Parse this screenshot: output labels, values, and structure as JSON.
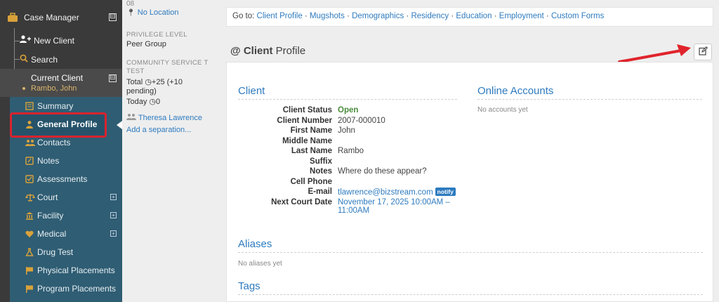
{
  "sidebar": {
    "case_manager": "Case Manager",
    "new_client": "New Client",
    "search": "Search",
    "current_client_label": "Current Client",
    "current_client_name": "Rambo, John",
    "toggle_symbol": "⊟",
    "items": [
      {
        "label": "Summary",
        "icon": "summary-icon"
      },
      {
        "label": "General Profile",
        "icon": "person-icon"
      },
      {
        "label": "Contacts",
        "icon": "contacts-icon"
      },
      {
        "label": "Notes",
        "icon": "notes-icon"
      },
      {
        "label": "Assessments",
        "icon": "assessments-icon"
      },
      {
        "label": "Court",
        "icon": "scales-icon",
        "expandable": true
      },
      {
        "label": "Facility",
        "icon": "building-icon",
        "expandable": true
      },
      {
        "label": "Medical",
        "icon": "heart-icon",
        "expandable": true
      },
      {
        "label": "Drug Test",
        "icon": "flask-icon"
      },
      {
        "label": "Physical Placements",
        "icon": "flag-icon"
      },
      {
        "label": "Program Placements",
        "icon": "flag-icon"
      }
    ],
    "plus_symbol": "+"
  },
  "midcol": {
    "top_fragment": "08",
    "location": "No Location",
    "privilege_label": "PRIVILEGE LEVEL",
    "privilege_value": "Peer Group",
    "community_label_1": "COMMUNITY SERVICE T",
    "community_label_2": "TEST",
    "total_text": "Total",
    "total_value": "+25 (+10",
    "total_pending": "pending)",
    "today_text": "Today",
    "today_value": "0",
    "caseworker": "Theresa Lawrence",
    "add_separation": "Add a separation..."
  },
  "main": {
    "goto_prefix": "Go to:",
    "goto_links": [
      "Client Profile",
      "Mugshots",
      "Demographics",
      "Residency",
      "Education",
      "Employment",
      "Custom Forms"
    ],
    "separator": " · ",
    "title_at": "@",
    "title_bold": "Client",
    "title_rest": "Profile",
    "client_section": "Client",
    "online_section": "Online Accounts",
    "online_empty": "No accounts yet",
    "aliases_section": "Aliases",
    "aliases_empty": "No aliases yet",
    "tags_section": "Tags",
    "notify_badge": "notify",
    "fields": [
      {
        "label": "Client Status",
        "value": "Open"
      },
      {
        "label": "Client Number",
        "value": "2007-000010"
      },
      {
        "label": "First Name",
        "value": "John"
      },
      {
        "label": "Middle Name",
        "value": ""
      },
      {
        "label": "Last Name",
        "value": "Rambo"
      },
      {
        "label": "Suffix",
        "value": ""
      },
      {
        "label": "Notes",
        "value": "Where do these appear?"
      },
      {
        "label": "Cell Phone",
        "value": ""
      },
      {
        "label": "E-mail",
        "value": "tlawrence@bizstream.com"
      },
      {
        "label": "Next Court Date",
        "value": "November 17, 2025 10:00AM –",
        "value2": "11:00AM"
      }
    ]
  },
  "colors": {
    "link": "#2e7bbf",
    "open_status": "#4a8a3a",
    "highlight": "#d9232f",
    "submenu_bg": "#2f5d73",
    "sidebar_bg": "#3a3a3a"
  }
}
